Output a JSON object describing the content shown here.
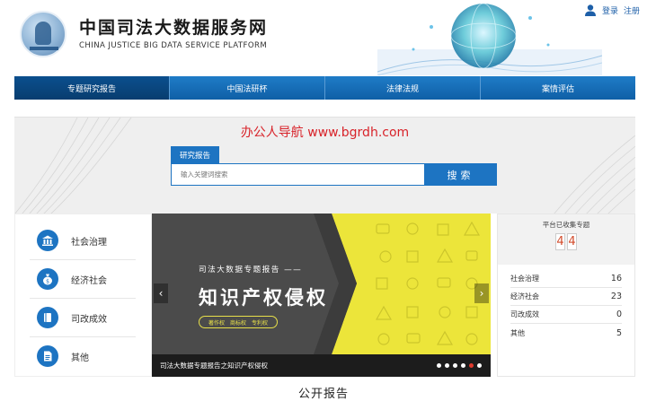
{
  "header": {
    "title": "中国司法大数据服务网",
    "subtitle": "CHINA JUSTICE BIG DATA SERVICE PLATFORM",
    "login": "登录",
    "register": "注册"
  },
  "nav": [
    {
      "label": "专题研究报告",
      "active": true
    },
    {
      "label": "中国法研杯"
    },
    {
      "label": "法律法规"
    },
    {
      "label": "案情评估"
    }
  ],
  "banner": {
    "promo": "办公人导航  www.bgrdh.com",
    "search_tab": "研究报告",
    "search_placeholder": "输入关键词搜索",
    "search_button": "搜索"
  },
  "categories": [
    {
      "label": "社会治理",
      "icon": "building-icon"
    },
    {
      "label": "经济社会",
      "icon": "money-bag-icon"
    },
    {
      "label": "司改成效",
      "icon": "book-icon"
    },
    {
      "label": "其他",
      "icon": "document-icon"
    }
  ],
  "slider": {
    "subtitle": "司法大数据专题报告 ——",
    "title": "知识产权侵权",
    "tags": [
      "著作权",
      "商标权",
      "专利权"
    ],
    "caption": "司法大数据专题报告之知识产权侵权",
    "slide_count": 6,
    "active_index": 4
  },
  "stats": {
    "header": "平台已收集专题",
    "total_digits": [
      "4",
      "4"
    ],
    "rows": [
      {
        "label": "社会治理",
        "value": "16"
      },
      {
        "label": "经济社会",
        "value": "23"
      },
      {
        "label": "司改成效",
        "value": "0"
      },
      {
        "label": "其他",
        "value": "5"
      }
    ]
  },
  "section_heading": "公开报告",
  "colors": {
    "primary_blue": "#1d74c2",
    "nav_active": "#0b4f8e",
    "slide_yellow": "#ece53a",
    "promo_red": "#d8232a"
  }
}
